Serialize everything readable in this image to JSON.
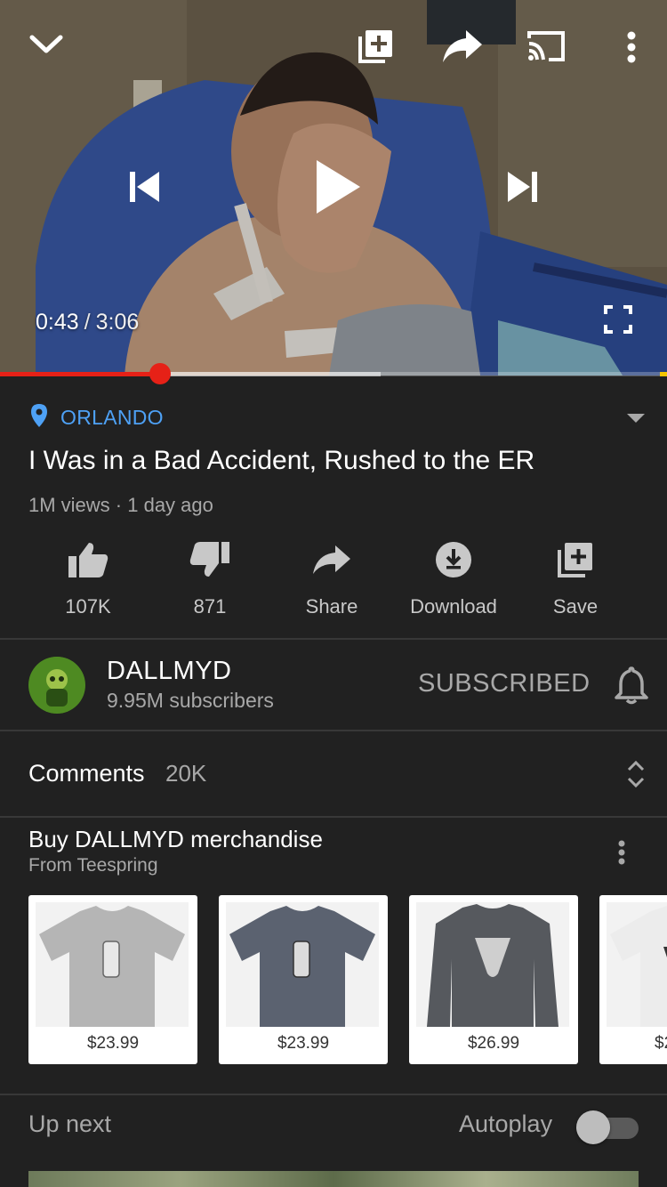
{
  "player": {
    "current_time": "0:43",
    "separator": "/",
    "duration": "3:06",
    "progress_played": 0.24,
    "progress_buffered": 0.57,
    "icons": [
      "chevron-down-icon",
      "add-to-playlist-icon",
      "share-icon",
      "cast-icon",
      "more-vert-icon",
      "previous-icon",
      "play-icon",
      "next-icon",
      "fullscreen-icon"
    ]
  },
  "video": {
    "location": "ORLANDO",
    "title": "I Was in a Bad Accident, Rushed to the ER",
    "meta": "1M views · 1 day ago"
  },
  "actions": [
    {
      "label": "107K",
      "icon": "thumb-up-icon"
    },
    {
      "label": "871",
      "icon": "thumb-down-icon"
    },
    {
      "label": "Share",
      "icon": "share-icon"
    },
    {
      "label": "Download",
      "icon": "download-icon"
    },
    {
      "label": "Save",
      "icon": "add-to-playlist-icon"
    }
  ],
  "channel": {
    "name": "DALLMYD",
    "subscribers": "9.95M subscribers",
    "subscribe_label": "SUBSCRIBED"
  },
  "comments": {
    "label": "Comments",
    "count": "20K"
  },
  "merch": {
    "title": "Buy DALLMYD merchandise",
    "subtitle": "From Teespring",
    "items": [
      {
        "price": "$23.99",
        "color": "#b5b5b5"
      },
      {
        "price": "$23.99",
        "color": "#5b6270"
      },
      {
        "price": "$26.99",
        "color": "#56595e"
      },
      {
        "price": "$2",
        "color": "#f0f0f0"
      }
    ]
  },
  "upnext": {
    "label": "Up next",
    "autoplay_label": "Autoplay",
    "autoplay_on": false
  },
  "colors": {
    "background": "#212121",
    "accent_red": "#e62117",
    "link_blue": "#4ea1f5",
    "secondary_text": "#a8a8a8"
  }
}
